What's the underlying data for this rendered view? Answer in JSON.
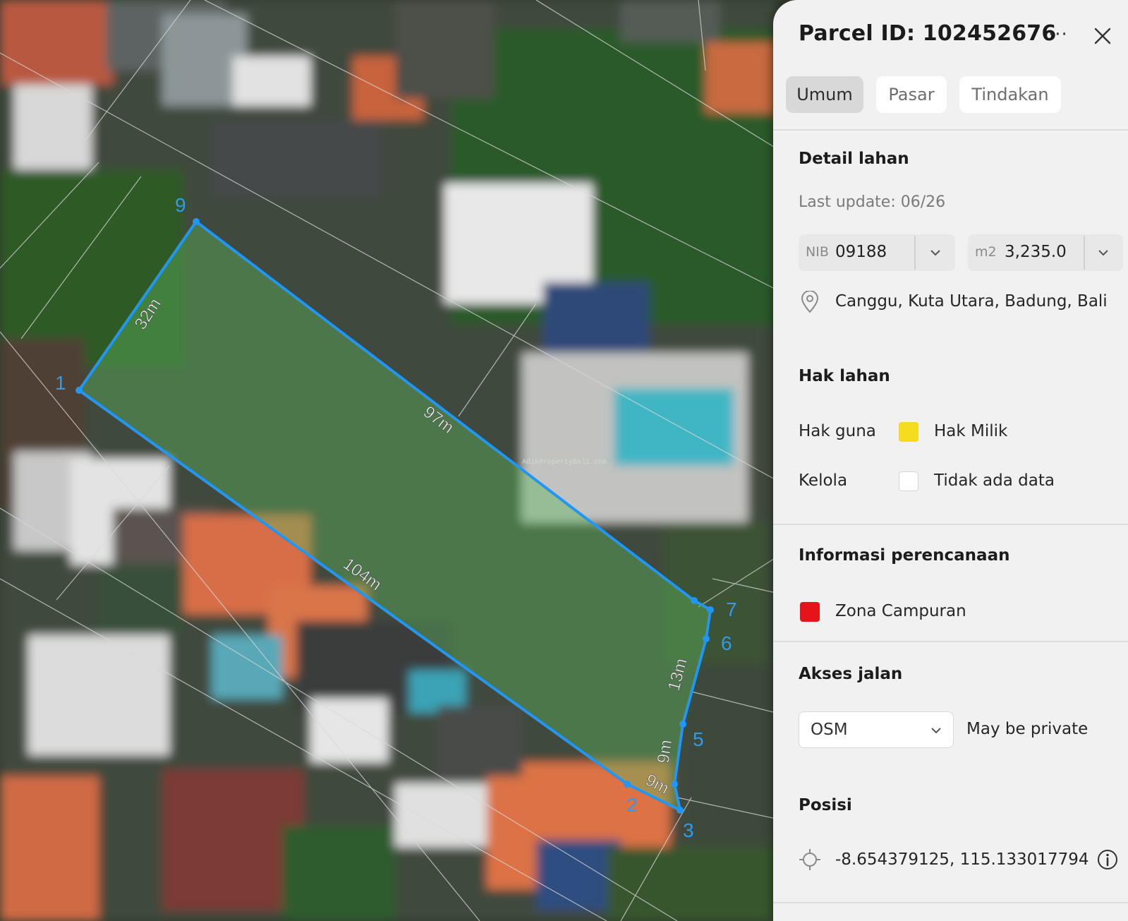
{
  "map": {
    "vertex_labels": [
      "1",
      "2",
      "3",
      "5",
      "6",
      "7",
      "9"
    ],
    "edge_labels": [
      "32m",
      "97m",
      "104m",
      "13m",
      "9m",
      "9m"
    ],
    "watermark": "AdikPropertyBali.com",
    "accent_color": "#2196f3"
  },
  "panel": {
    "title": "Parcel ID: 102452676",
    "more_label": "···",
    "tabs": [
      {
        "label": "Umum",
        "active": true
      },
      {
        "label": "Pasar",
        "active": false
      },
      {
        "label": "Tindakan",
        "active": false
      }
    ],
    "detail": {
      "heading": "Detail lahan",
      "last_update": "Last update: 06/26",
      "nib_label": "NIB",
      "nib_value": "09188",
      "area_label": "m2",
      "area_value": "3,235.0",
      "location": "Canggu, Kuta Utara, Badung, Bali"
    },
    "rights": {
      "heading": "Hak lahan",
      "use_label": "Hak guna",
      "use_value": "Hak Milik",
      "use_color": "#f5dc1e",
      "manage_label": "Kelola",
      "manage_value": "Tidak ada data",
      "manage_color": "#ffffff"
    },
    "planning": {
      "heading": "Informasi perencanaan",
      "zone": "Zona Campuran",
      "zone_color": "#e5141b"
    },
    "road": {
      "heading": "Akses jalan",
      "source": "OSM",
      "note": "May be private"
    },
    "position": {
      "heading": "Posisi",
      "coords": "-8.654379125, 115.133017794"
    }
  }
}
